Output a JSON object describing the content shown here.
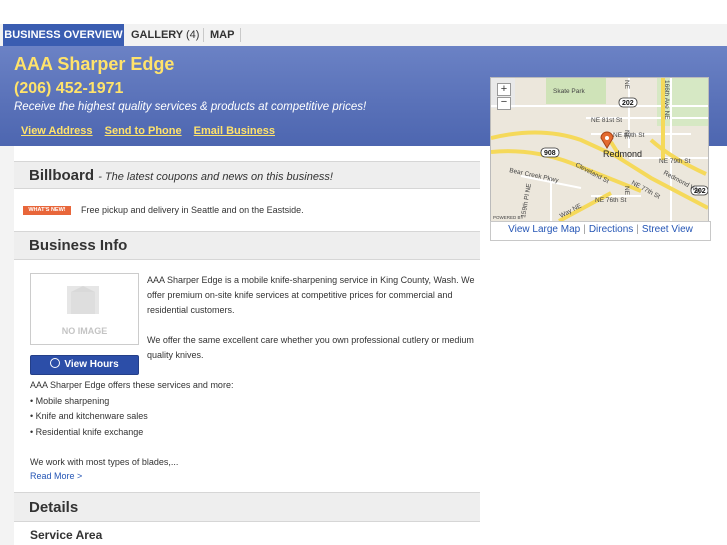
{
  "tabs": [
    {
      "label": "BUSINESS OVERVIEW"
    },
    {
      "label": "GALLERY",
      "count": "(4)"
    },
    {
      "label": "MAP"
    }
  ],
  "business": {
    "name": "AAA Sharper Edge",
    "phone": "(206) 452-1971",
    "tagline": "Receive the highest quality services & products at competitive prices!",
    "links": [
      "View Address",
      "Send to Phone",
      "Email Business"
    ]
  },
  "billboard": {
    "title": "Billboard",
    "subtitle": "- The latest coupons and news on this business!",
    "badge": "WHAT'S NEW!",
    "text": "Free pickup and delivery in Seattle and on the Eastside."
  },
  "business_info": {
    "title": "Business Info",
    "no_image": "NO IMAGE",
    "view_hours": "View Hours",
    "desc1": "AAA Sharper Edge is a mobile knife-sharpening service in King County, Wash. We offer premium on-site knife services at competitive prices for commercial and residential customers.",
    "desc2": "We offer the same excellent care whether you own professional cutlery or medium quality knives.",
    "services_intro": "AAA Sharper Edge offers these services and more:",
    "services": [
      "• Mobile sharpening",
      "• Knife and kitchenware sales",
      "• Residential knife exchange"
    ],
    "blades": "We work with most types of blades,...",
    "read_more": "Read More >"
  },
  "details": {
    "title": "Details",
    "service_area": "Service Area"
  },
  "map": {
    "zoom_in": "+",
    "zoom_out": "−",
    "labels": [
      "Skate Park",
      "NE 81st St",
      "NE 80th St",
      "Redmond",
      "NE 79th St",
      "Redmond Way",
      "Cleveland St",
      "NE 77th St",
      "NE 76th St",
      "Bear Creek Pkwy",
      "159th Pl NE",
      "Way NE",
      "166th Ave NE",
      "NE",
      "NE",
      "NE",
      "POWERED BY"
    ],
    "shields": [
      "202",
      "908",
      "202"
    ],
    "links": [
      "View Large Map",
      "Directions",
      "Street View"
    ]
  },
  "colors": {
    "tab_active": "#3a5db1",
    "banner": "#5a72b9",
    "highlight": "#ffe36b",
    "link": "#2455b5",
    "badge": "#e8663a"
  }
}
